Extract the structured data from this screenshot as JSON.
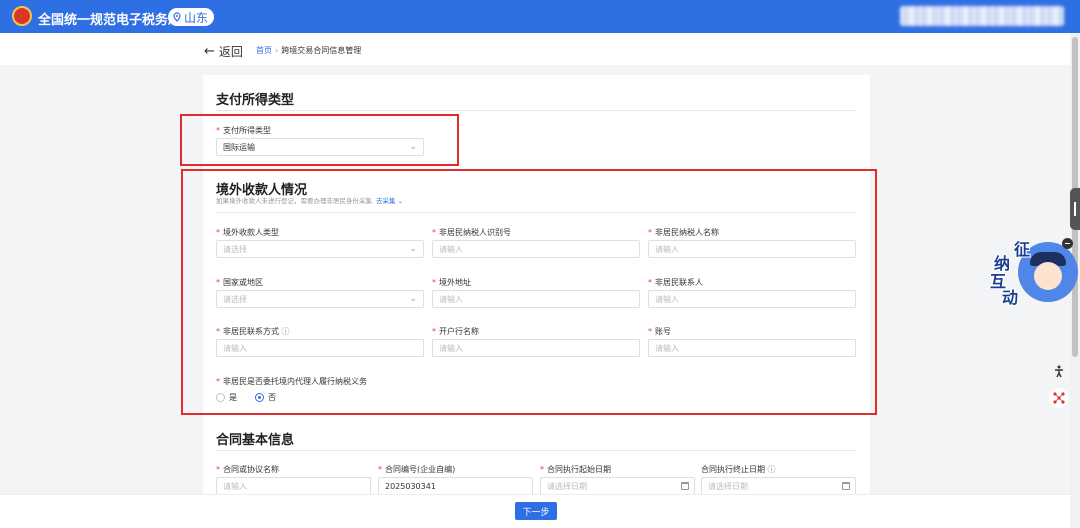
{
  "header": {
    "title": "全国统一规范电子税务局",
    "region": "山东"
  },
  "nav": {
    "back_label": "返回",
    "breadcrumbs": [
      "首页",
      "跨境交易合同信息管理"
    ]
  },
  "section_payment": {
    "title": "支付所得类型",
    "field_label": "支付所得类型",
    "field_value": "国际运输"
  },
  "section_payee": {
    "title": "境外收款人情况",
    "hint": "如果境外收款人未进行登记，需要办理非居民身份采集",
    "hint_link": "去采集",
    "fields": [
      {
        "label": "境外收款人类型",
        "placeholder": "请选择",
        "type": "select"
      },
      {
        "label": "非居民纳税人识别号",
        "placeholder": "请输入",
        "type": "input"
      },
      {
        "label": "非居民纳税人名称",
        "placeholder": "请输入",
        "type": "input"
      },
      {
        "label": "国家或地区",
        "placeholder": "请选择",
        "type": "select"
      },
      {
        "label": "境外地址",
        "placeholder": "请输入",
        "type": "input"
      },
      {
        "label": "非居民联系人",
        "placeholder": "请输入",
        "type": "input"
      },
      {
        "label": "非居民联系方式",
        "placeholder": "请输入",
        "type": "input"
      },
      {
        "label": "开户行名称",
        "placeholder": "请输入",
        "type": "input"
      },
      {
        "label": "账号",
        "placeholder": "请输入",
        "type": "input"
      }
    ],
    "agent_question": "非居民是否委托境内代理人履行纳税义务",
    "agent_options": [
      "是",
      "否"
    ],
    "agent_selected": "否"
  },
  "section_contract": {
    "title": "合同基本信息",
    "fields": [
      {
        "label": "合同或协议名称",
        "value": "",
        "placeholder": "请输入"
      },
      {
        "label": "合同编号(企业自编)",
        "value": "2025030341",
        "placeholder": ""
      },
      {
        "label": "合同执行起始日期",
        "value": "",
        "placeholder": "请选择日期"
      },
      {
        "label": "合同执行终止日期",
        "value": "",
        "placeholder": "请选择日期"
      }
    ]
  },
  "footer": {
    "next_label": "下一步"
  },
  "assistant": {
    "chars": [
      "征",
      "纳",
      "互",
      "动"
    ]
  },
  "colors": {
    "primary": "#2f6fe4",
    "highlight": "#e02c2c",
    "required": "#e8443a"
  }
}
